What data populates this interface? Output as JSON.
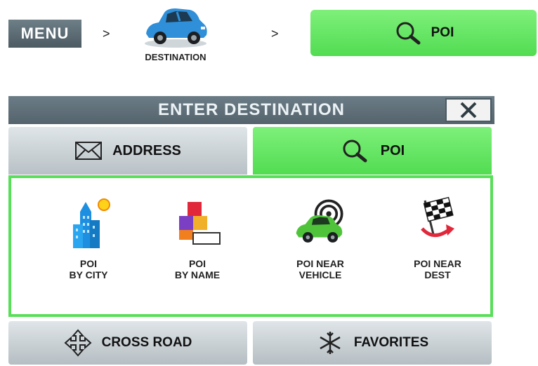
{
  "breadcrumb": {
    "menu_label": "MENU",
    "separator": ">",
    "destination_label": "DESTINATION",
    "poi_label": "POI"
  },
  "panel": {
    "title": "ENTER DESTINATION",
    "close_glyph": "✕"
  },
  "tabs": [
    {
      "label": "ADDRESS",
      "icon": "envelope-icon",
      "active": false
    },
    {
      "label": "POI",
      "icon": "magnifier-icon",
      "active": true
    }
  ],
  "options": [
    {
      "label": "POI\nBY CITY",
      "icon": "city-building-icon"
    },
    {
      "label": "POI\nBY NAME",
      "icon": "blocks-name-icon"
    },
    {
      "label": "POI NEAR\nVEHICLE",
      "icon": "car-target-icon"
    },
    {
      "label": "POI NEAR\nDEST",
      "icon": "checkered-flag-icon"
    }
  ],
  "bottom_buttons": [
    {
      "label": "CROSS ROAD",
      "icon": "crossroad-arrows-icon"
    },
    {
      "label": "FAVORITES",
      "icon": "favorites-star-icon"
    }
  ],
  "colors": {
    "accent_green": "#58df58",
    "header_slate": "#5b6a73",
    "button_gray": "#c9d1d5"
  }
}
